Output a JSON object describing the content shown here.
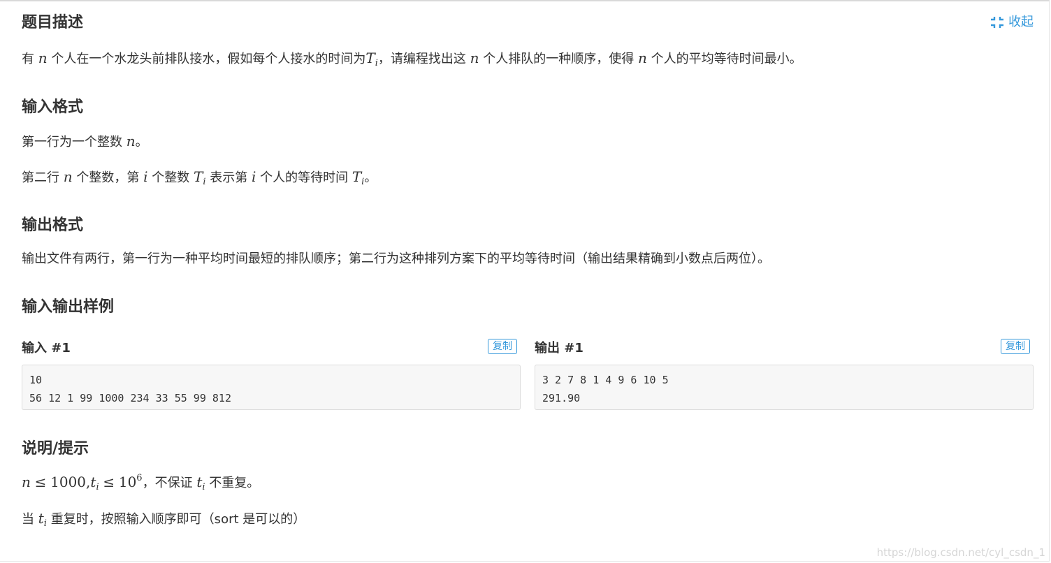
{
  "collapse": {
    "label": "收起",
    "icon": "collapse-icon",
    "color": "#3498db"
  },
  "description": {
    "title": "题目描述",
    "text_1": "有",
    "var_n": "n",
    "text_2": "个人在一个水龙头前排队接水，假如每个人接水的时间为",
    "var_T": "T",
    "sub_i": "i",
    "text_3": "，请编程找出这",
    "text_4": "个人排队的一种顺序，使得",
    "text_5": "个人的平均等待时间最小。"
  },
  "input_format": {
    "title": "输入格式",
    "line1_text": "第一行为一个整数",
    "line1_end": "。",
    "line2_a": "第二行",
    "line2_b": "个整数，第",
    "line2_c": "个整数",
    "line2_d": "表示第",
    "line2_e": "个人的等待时间",
    "line2_end": "。",
    "var_n": "n",
    "var_i": "i",
    "var_T": "T",
    "sub_i": "i"
  },
  "output_format": {
    "title": "输出格式",
    "text": "输出文件有两行，第一行为一种平均时间最短的排队顺序；第二行为这种排列方案下的平均等待时间（输出结果精确到小数点后两位）。"
  },
  "samples": {
    "title": "输入输出样例",
    "input_label": "输入 #1",
    "output_label": "输出 #1",
    "copy_label": "复制",
    "input_lines": [
      "10",
      "56 12 1 99 1000 234 33 55 99 812"
    ],
    "output_lines": [
      "3 2 7 8 1 4 9 6 10 5",
      "291.90"
    ]
  },
  "hint": {
    "title": "说明/提示",
    "math_n": "n",
    "math_le": "≤",
    "math_1000": "1000,",
    "math_t": "t",
    "math_sub_i": "i",
    "math_10": "10",
    "math_exp": "6",
    "text_a": "，不保证",
    "text_b": "不重复。",
    "line2_a": "当",
    "line2_b": "重复时，按照输入顺序即可（sort 是可以的）"
  },
  "watermark": "https://blog.csdn.net/cyl_csdn_1"
}
